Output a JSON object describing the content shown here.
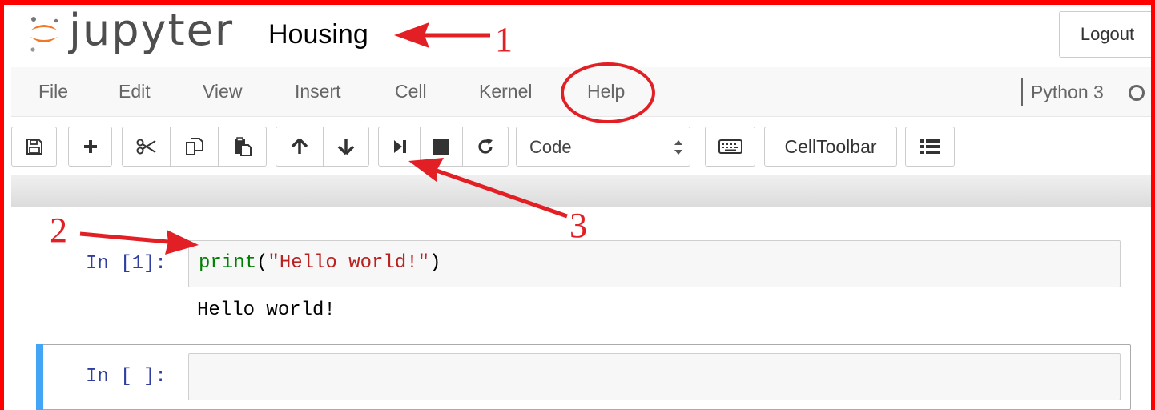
{
  "header": {
    "logo_text": "jupyter",
    "notebook_name": "Housing",
    "logout_label": "Logout"
  },
  "menubar": {
    "items": [
      {
        "label": "File"
      },
      {
        "label": "Edit"
      },
      {
        "label": "View"
      },
      {
        "label": "Insert"
      },
      {
        "label": "Cell"
      },
      {
        "label": "Kernel"
      },
      {
        "label": "Help"
      }
    ],
    "kernel_name": "Python 3",
    "kernel_status": "idle"
  },
  "toolbar": {
    "icons": [
      "save-icon",
      "plus-icon",
      "scissors-icon",
      "copy-icon",
      "paste-icon",
      "arrow-up-icon",
      "arrow-down-icon",
      "run-next-icon",
      "stop-icon",
      "restart-icon",
      "keyboard-icon",
      "list-icon"
    ],
    "cell_type_selected": "Code",
    "celltoolbar_label": "CellToolbar"
  },
  "cells": [
    {
      "prompt": "In [1]:",
      "code": {
        "builtin": "print",
        "open": "(",
        "string": "\"Hello world!\"",
        "close": ")"
      },
      "output": "Hello world!"
    },
    {
      "prompt": "In [ ]:",
      "code": ""
    }
  ],
  "annotations": {
    "labels": [
      "1",
      "2",
      "3"
    ],
    "color": "#e31f26"
  },
  "colors": {
    "frame": "#ff0000",
    "prompt": "#303f9f",
    "builtin": "#008000",
    "string": "#ba2121",
    "selected_cell_bar": "#42a5f5"
  }
}
